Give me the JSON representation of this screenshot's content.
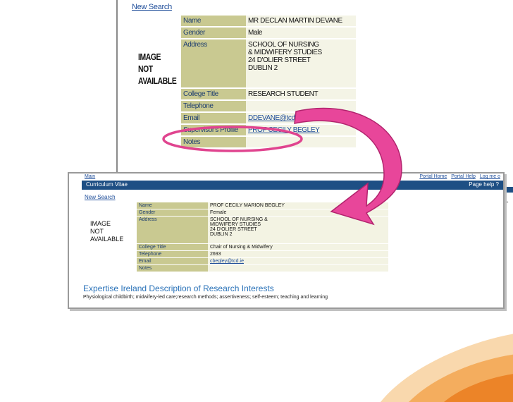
{
  "top_window": {
    "new_search": "New Search",
    "image_lines": [
      "IMAGE",
      "NOT",
      "AVAILABLE"
    ],
    "rows": [
      {
        "label": "Name",
        "value": "MR DECLAN MARTIN DEVANE"
      },
      {
        "label": "Gender",
        "value": "Male"
      },
      {
        "label": "Address",
        "value_lines": [
          "SCHOOL OF NURSING",
          "& MIDWIFERY STUDIES",
          "24 D'OLIER STREET",
          "DUBLIN 2"
        ]
      },
      {
        "label": "College Title",
        "value": "RESEARCH STUDENT"
      },
      {
        "label": "Telephone",
        "value": ""
      },
      {
        "label": "Email",
        "value": "DDEVANE@tcd.ie"
      },
      {
        "label": "Supervisor's Profile",
        "value": "PROF CECILY BEGLEY"
      },
      {
        "label": "Notes",
        "value": ""
      }
    ]
  },
  "front_window": {
    "menu_left": "Main",
    "menu_right": [
      "Portal Home",
      "Portal Help",
      "Log me o"
    ],
    "title": "Curriculum Vitae",
    "page_help": "Page help ?",
    "new_search": "New Search",
    "image_lines": [
      "IMAGE",
      "NOT",
      "AVAILABLE"
    ],
    "rows": [
      {
        "label": "Name",
        "value": "PROF CECILY MARION BEGLEY"
      },
      {
        "label": "Gender",
        "value": "Female"
      },
      {
        "label": "Address",
        "value_lines": [
          "SCHOOL OF NURSING &",
          "MIDWIFERY STUDIES",
          "24 D'OLIER STREET",
          "DUBLIN 2"
        ]
      },
      {
        "label": "College Title",
        "value": "Chair of Nursing & Midwifery"
      },
      {
        "label": "Telephone",
        "value": "2693"
      },
      {
        "label": "Email",
        "value": "cbegley@tcd.ie"
      },
      {
        "label": "Notes",
        "value": ""
      }
    ],
    "expertise_heading": "Expertise Ireland Description of Research Interests",
    "interests_text": "Physiological childbirth; midwifery-led care;research methods; assertiveness; self-esteem; teaching and learning"
  },
  "right_cut_text": "d of n-",
  "colors": {
    "highlight_pink": "#e0448f",
    "arrow_pink": "#e8469a",
    "header_blue": "#1e4f84",
    "label_khaki": "#c9c991",
    "link_blue": "#1f4e9a"
  }
}
